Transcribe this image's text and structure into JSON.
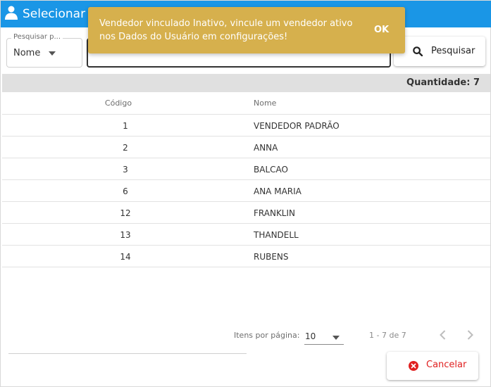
{
  "header": {
    "title": "Selecionar V",
    "icon": "user-icon"
  },
  "search": {
    "by_legend": "Pesquisar p...",
    "by_value": "Nome",
    "input_value": "",
    "button_label": "Pesquisar",
    "button_icon": "search-icon"
  },
  "quantity_label": "Quantidade: 7",
  "table": {
    "columns": [
      "Código",
      "Nome"
    ],
    "rows": [
      {
        "code": "1",
        "name": "VENDEDOR PADRÃO"
      },
      {
        "code": "2",
        "name": "ANNA"
      },
      {
        "code": "3",
        "name": "BALCAO"
      },
      {
        "code": "6",
        "name": "ANA MARIA"
      },
      {
        "code": "12",
        "name": "FRANKLIN"
      },
      {
        "code": "13",
        "name": "THANDELL"
      },
      {
        "code": "14",
        "name": "RUBENS"
      }
    ]
  },
  "paginator": {
    "items_per_page_label": "Itens por página:",
    "items_per_page_value": "10",
    "range_label": "1 - 7 de 7"
  },
  "footer": {
    "cancel_label": "Cancelar",
    "cancel_icon": "close-circle-icon"
  },
  "snackbar": {
    "message": "Vendedor vinculado Inativo, vincule um vendedor ativo nos Dados do Usuário em configurações!",
    "action": "OK"
  },
  "colors": {
    "header": "#1a96e6",
    "snackbar": "#d6b04d",
    "cancel": "#e02020"
  }
}
